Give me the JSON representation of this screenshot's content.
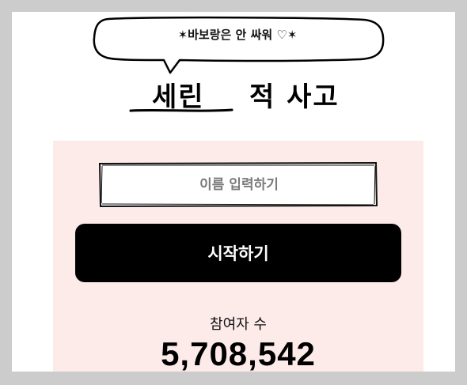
{
  "header": {
    "bubble_text": "✶바보랑은 안 싸워 ♡✶",
    "title_left": "세린",
    "title_right": "적 사고"
  },
  "form": {
    "name_placeholder": "이름 입력하기",
    "name_value": "",
    "start_label": "시작하기"
  },
  "stats": {
    "participants_label": "참여자 수",
    "participants_count": "5,708,542"
  }
}
